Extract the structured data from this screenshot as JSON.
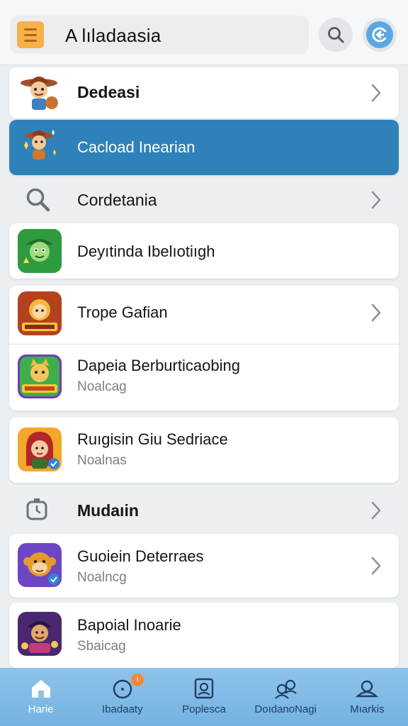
{
  "header": {
    "title": "A lıladaasia",
    "menu_icon": "hamburger-menu-icon",
    "search_icon": "search-icon",
    "back_icon": "back-arrow-icon",
    "accent": "#5aa7e2",
    "menu_color": "#f7b04a"
  },
  "list": {
    "items": [
      {
        "title": "Dedeasi",
        "icon": "cowboy-game-icon",
        "chevron": true
      },
      {
        "title": "Cacload Inearian",
        "icon": "cowboy-game-icon",
        "selected": true
      },
      {
        "title": "Cordetania",
        "icon": "search-icon",
        "chevron": true
      },
      {
        "title": "Deyıtinda Ibelıotiıgh",
        "icon": "green-character-app-icon"
      },
      {
        "title": "Trope Gafian",
        "icon": "golden-hero-app-icon",
        "chevron": true
      },
      {
        "title": "Dapeia Berburticaobing",
        "subtitle": "Noalcag",
        "icon": "cat-character-app-icon"
      },
      {
        "title": "Ruıgisin Giu Sedriace",
        "subtitle": "Noalnas",
        "icon": "red-hair-girl-app-icon"
      },
      {
        "title": "Mudaıin",
        "icon": "timer-icon",
        "chevron": true
      },
      {
        "title": "Guoiein Deterraes",
        "subtitle": "Noalncg",
        "icon": "monkey-character-app-icon",
        "chevron": true
      },
      {
        "title": "Bapoial Inoarie",
        "subtitle": "Sbaicag",
        "icon": "purple-hero-app-icon"
      }
    ],
    "selected_color": "#2f81ba"
  },
  "bottom_nav": {
    "items": [
      {
        "label": "Harie",
        "icon": "home-icon",
        "active": true
      },
      {
        "label": "Ibadaaty",
        "icon": "clock-icon",
        "badge": "!"
      },
      {
        "label": "Poplesca",
        "icon": "gallery-icon"
      },
      {
        "label": "DoıdanoNagi",
        "icon": "people-icon"
      },
      {
        "label": "Mıarkis",
        "icon": "profile-icon"
      }
    ],
    "background": "#8ec3ea"
  }
}
